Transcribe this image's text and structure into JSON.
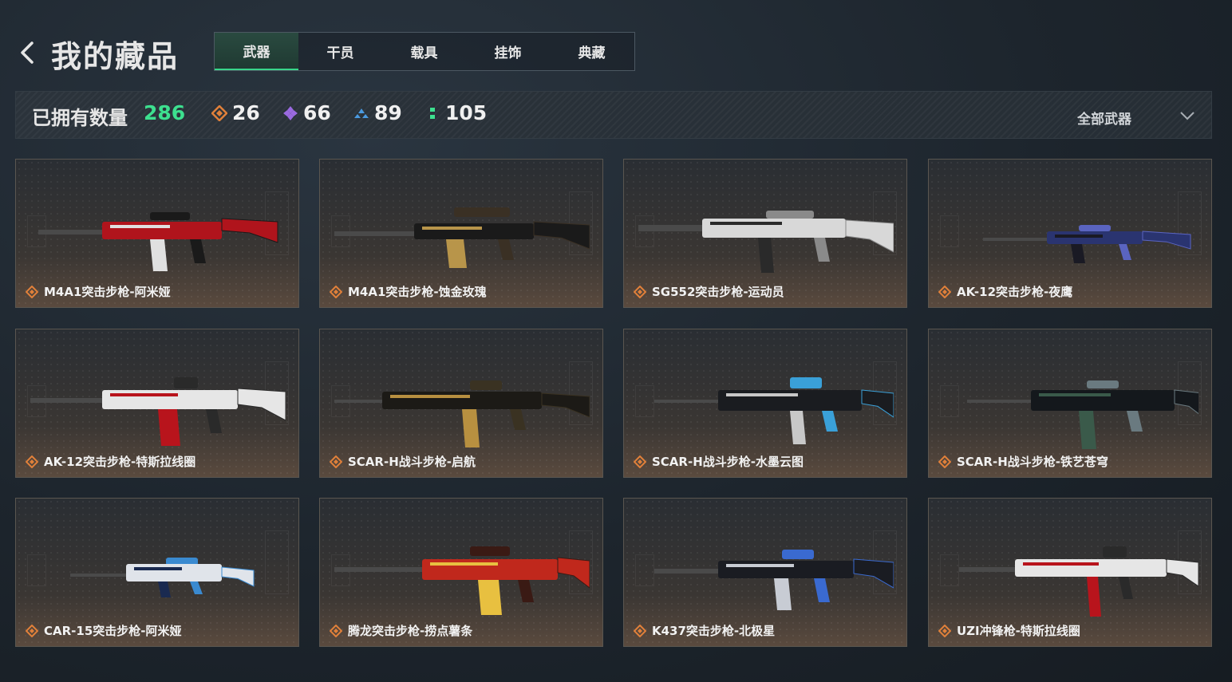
{
  "header": {
    "title": "我的藏品",
    "tabs": [
      {
        "label": "武器",
        "active": true
      },
      {
        "label": "干员",
        "active": false
      },
      {
        "label": "载具",
        "active": false
      },
      {
        "label": "挂饰",
        "active": false
      },
      {
        "label": "典藏",
        "active": false
      }
    ]
  },
  "stats": {
    "owned_label": "已拥有数量",
    "owned_count": "286",
    "rarities": [
      {
        "icon": "orange-diamond-icon",
        "color": "#e0803a",
        "count": "26"
      },
      {
        "icon": "purple-diamond-icon",
        "color": "#9a6ae0",
        "count": "66"
      },
      {
        "icon": "blue-triangle-icon",
        "color": "#4a9ae0",
        "count": "89"
      },
      {
        "icon": "green-dots-icon",
        "color": "#3de08f",
        "count": "105"
      }
    ],
    "filter_label": "全部武器"
  },
  "colors": {
    "accent_green": "#3de08f",
    "rarity_orange": "#e0803a"
  },
  "items": [
    {
      "name": "M4A1突击步枪-阿米娅",
      "rarity": "orange",
      "palette": [
        "#b0141c",
        "#e0e0e0",
        "#1a1a1a"
      ]
    },
    {
      "name": "M4A1突击步枪-蚀金玫瑰",
      "rarity": "orange",
      "palette": [
        "#1a1a1a",
        "#b8954a",
        "#3a3024"
      ]
    },
    {
      "name": "SG552突击步枪-运动员",
      "rarity": "orange",
      "palette": [
        "#d8d8d8",
        "#2a2a2a",
        "#8a8a8a"
      ]
    },
    {
      "name": "AK-12突击步枪-夜鹰",
      "rarity": "orange",
      "palette": [
        "#2a3470",
        "#1a1a24",
        "#5a64c0"
      ]
    },
    {
      "name": "AK-12突击步枪-特斯拉线圈",
      "rarity": "orange",
      "palette": [
        "#e6e6e6",
        "#b8141c",
        "#2a2a2a"
      ]
    },
    {
      "name": "SCAR-H战斗步枪-启航",
      "rarity": "orange",
      "palette": [
        "#1c1a16",
        "#b89040",
        "#3a3222"
      ]
    },
    {
      "name": "SCAR-H战斗步枪-水墨云图",
      "rarity": "orange",
      "palette": [
        "#1a1c20",
        "#c8c8c8",
        "#3aa0d8"
      ]
    },
    {
      "name": "SCAR-H战斗步枪-铁艺苍穹",
      "rarity": "orange",
      "palette": [
        "#14181c",
        "#3a5a4a",
        "#6a7a80"
      ]
    },
    {
      "name": "CAR-15突击步枪-阿米娅",
      "rarity": "orange",
      "palette": [
        "#e0e4ea",
        "#1a2a50",
        "#3a8ad0"
      ]
    },
    {
      "name": "腾龙突击步枪-捞点薯条",
      "rarity": "orange",
      "palette": [
        "#c0281c",
        "#e8c040",
        "#3a1a14"
      ]
    },
    {
      "name": "K437突击步枪-北极星",
      "rarity": "orange",
      "palette": [
        "#1a1c22",
        "#c8ccd4",
        "#3a6ad0"
      ]
    },
    {
      "name": "UZI冲锋枪-特斯拉线圈",
      "rarity": "orange",
      "palette": [
        "#e6e6e6",
        "#b8141c",
        "#2a2a2a"
      ]
    }
  ]
}
